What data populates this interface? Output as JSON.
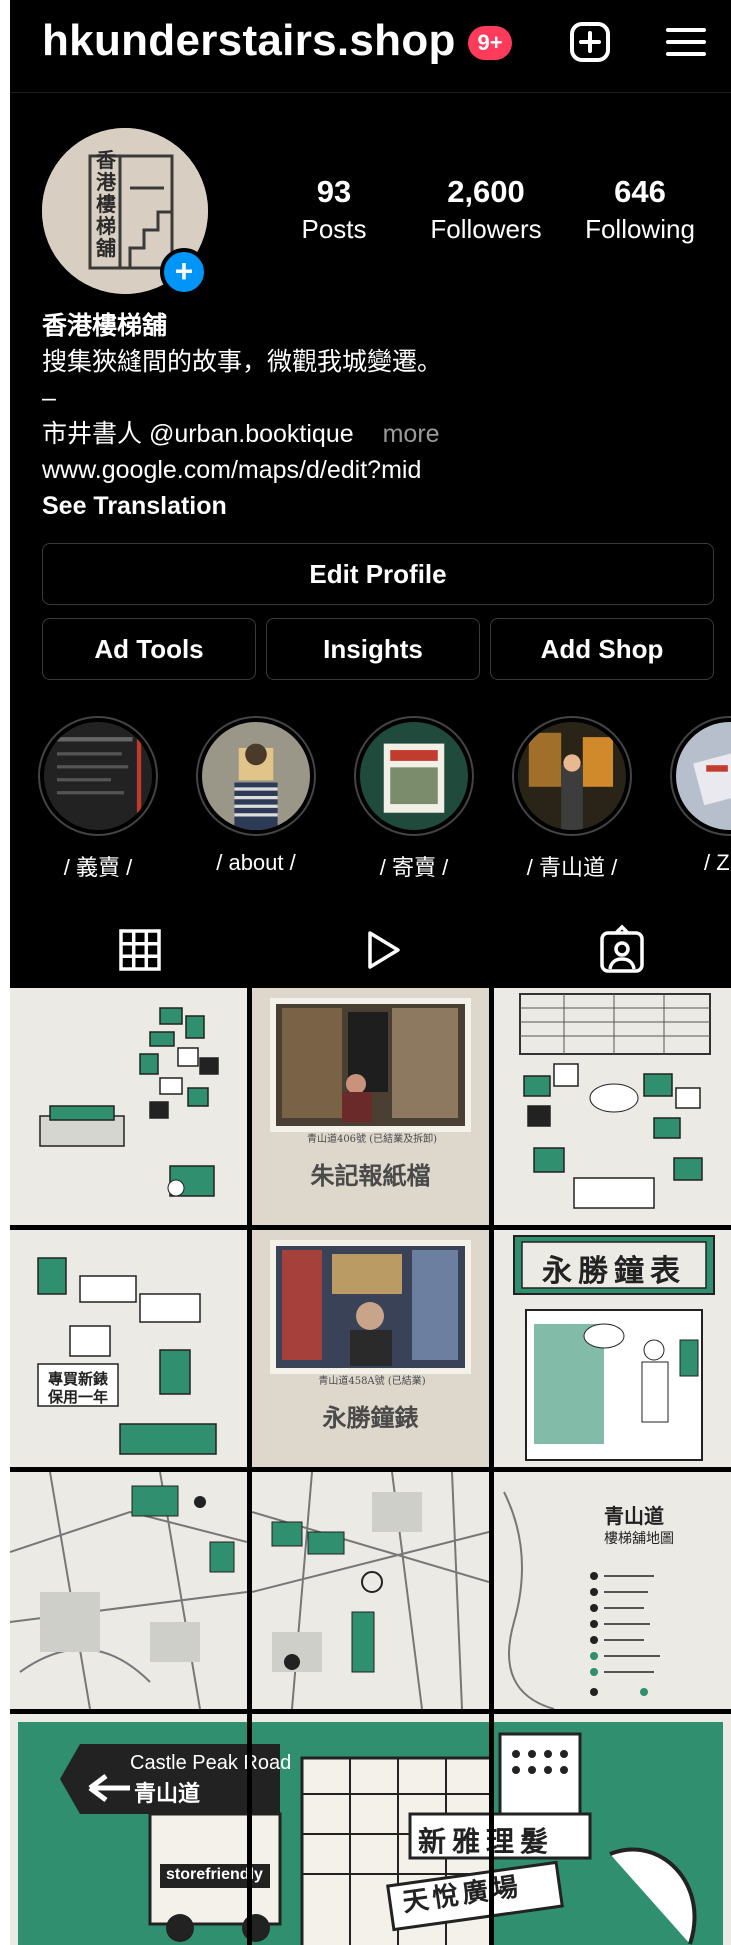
{
  "header": {
    "username": "hkunderstairs.shop",
    "notification_badge": "9+"
  },
  "profile": {
    "avatar_text": "香港樓梯舖",
    "stats": [
      {
        "value": "93",
        "label": "Posts"
      },
      {
        "value": "2,600",
        "label": "Followers"
      },
      {
        "value": "646",
        "label": "Following"
      }
    ],
    "display_name": "香港樓梯舖",
    "bio_line1": "搜集狹縫間的故事，微觀我城變遷。",
    "bio_dash": "–",
    "bio_line3": "市井書人 @urban.booktique",
    "more_label": "more",
    "link": "www.google.com/maps/d/edit?mid",
    "see_translation": "See Translation"
  },
  "buttons": {
    "edit_profile": "Edit Profile",
    "ad_tools": "Ad Tools",
    "insights": "Insights",
    "add_shop": "Add Shop"
  },
  "highlights": [
    {
      "label": "/ 義賣 /"
    },
    {
      "label": "/ about /"
    },
    {
      "label": "/ 寄賣 /"
    },
    {
      "label": "/ 青山道 /"
    },
    {
      "label": "/ Zi"
    }
  ],
  "tabs": [
    "grid",
    "reels",
    "tagged"
  ],
  "posts": {
    "p2_caption": "青山道406號 (已結業及拆卸)",
    "p2_title": "朱記報紙檔",
    "p5_caption": "青山道458A號 (已結業)",
    "p5_title": "永勝鐘錶",
    "p4_sign1": "專買新錶",
    "p4_sign2": "保用一年",
    "p6_sign": "永勝鐘表",
    "p9_title": "青山道",
    "p9_subtitle": "樓梯舖地圖",
    "banner_road_en": "Castle Peak Road",
    "banner_road_zh": "青山道",
    "banner_shop": "storefriendly",
    "banner_sign1": "新雅理髮",
    "banner_sign2": "天悅廣場"
  },
  "colors": {
    "accent_green": "#2f8f6f",
    "paper": "#eceae5",
    "badge": "#ff3b5c",
    "blue": "#0095f6"
  }
}
